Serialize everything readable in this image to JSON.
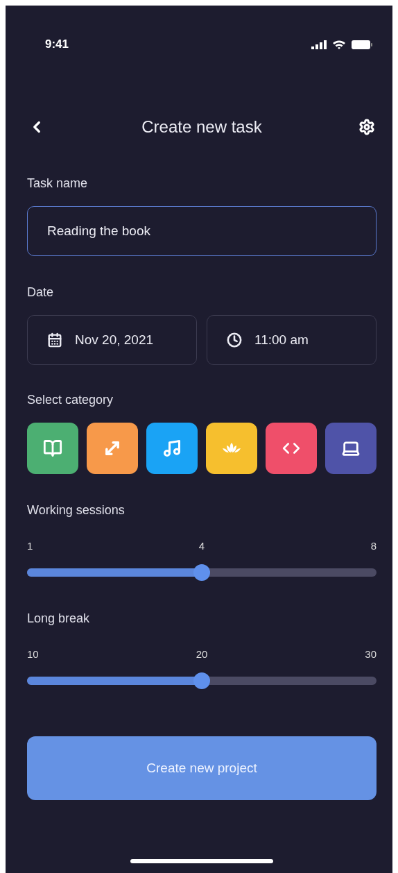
{
  "status_bar": {
    "time": "9:41"
  },
  "header": {
    "title": "Create new task"
  },
  "task_name": {
    "label": "Task name",
    "value": "Reading the book",
    "focused": true
  },
  "date": {
    "label": "Date",
    "date": "Nov 20, 2021",
    "time": "11:00 am"
  },
  "category": {
    "label": "Select category",
    "items": [
      {
        "kind": "book",
        "color": "#4caf72"
      },
      {
        "kind": "expand",
        "color": "#f7994a"
      },
      {
        "kind": "music",
        "color": "#1aa3f5"
      },
      {
        "kind": "lotus",
        "color": "#f6bf2e"
      },
      {
        "kind": "code",
        "color": "#ef4f6a"
      },
      {
        "kind": "laptop",
        "color": "#4f53a8"
      }
    ]
  },
  "sliders": [
    {
      "label": "Working sessions",
      "min": "1",
      "value": "4",
      "max": "8",
      "level": 0.5
    },
    {
      "label": "Long break",
      "min": "10",
      "value": "20",
      "max": "30",
      "level": 0.5
    }
  ],
  "submit": {
    "label": "Create new project"
  }
}
